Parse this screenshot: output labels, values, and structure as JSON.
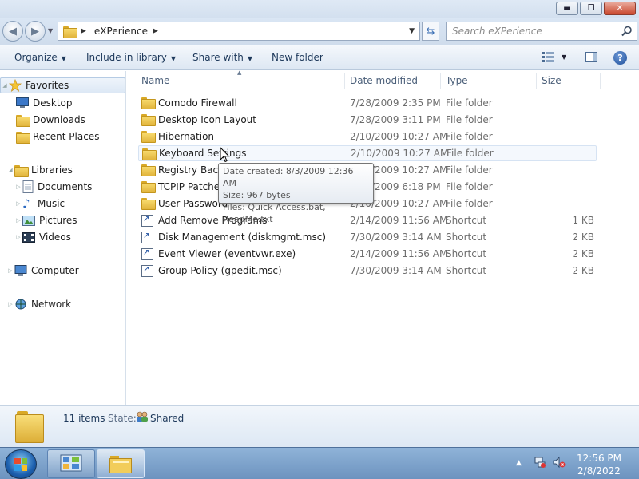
{
  "window": {
    "buttons": {
      "minimize": "▬",
      "maximize": "❐",
      "close": "✕"
    }
  },
  "address": {
    "path_segment": "eXPerience",
    "search_placeholder": "Search eXPerience"
  },
  "toolbar": {
    "organize": "Organize",
    "include_in_library": "Include in library",
    "share_with": "Share with",
    "new_folder": "New folder",
    "help": "?"
  },
  "nav": {
    "favorites": "Favorites",
    "desktop": "Desktop",
    "downloads": "Downloads",
    "recent_places": "Recent Places",
    "libraries": "Libraries",
    "documents": "Documents",
    "music": "Music",
    "pictures": "Pictures",
    "videos": "Videos",
    "computer": "Computer",
    "network": "Network"
  },
  "columns": {
    "name": "Name",
    "date": "Date modified",
    "type": "Type",
    "size": "Size"
  },
  "files": [
    {
      "name": "Comodo Firewall",
      "date": "7/28/2009 2:35 PM",
      "type": "File folder",
      "size": "",
      "icon": "folder-icon"
    },
    {
      "name": "Desktop Icon Layout",
      "date": "7/28/2009 3:11 PM",
      "type": "File folder",
      "size": "",
      "icon": "folder-icon"
    },
    {
      "name": "Hibernation",
      "date": "2/10/2009 10:27 AM",
      "type": "File folder",
      "size": "",
      "icon": "folder-icon"
    },
    {
      "name": "Keyboard Settings",
      "date": "2/10/2009 10:27 AM",
      "type": "File folder",
      "size": "",
      "icon": "folder-icon"
    },
    {
      "name": "Registry Backup",
      "date": "2/10/2009 10:27 AM",
      "type": "File folder",
      "size": "",
      "icon": "folder-icon"
    },
    {
      "name": "TCPIP Patcher",
      "date": "2/10/2009 6:18 PM",
      "type": "File folder",
      "size": "",
      "icon": "folder-icon"
    },
    {
      "name": "User Password",
      "date": "2/10/2009 10:27 AM",
      "type": "File folder",
      "size": "",
      "icon": "folder-icon"
    },
    {
      "name": "Add Remove Programs",
      "date": "2/14/2009 11:56 AM",
      "type": "Shortcut",
      "size": "1 KB",
      "icon": "shortcut-icon"
    },
    {
      "name": "Disk Management (diskmgmt.msc)",
      "date": "7/30/2009 3:14 AM",
      "type": "Shortcut",
      "size": "2 KB",
      "icon": "shortcut-icon"
    },
    {
      "name": "Event Viewer (eventvwr.exe)",
      "date": "2/14/2009 11:56 AM",
      "type": "Shortcut",
      "size": "2 KB",
      "icon": "shortcut-icon"
    },
    {
      "name": "Group Policy (gpedit.msc)",
      "date": "7/30/2009 3:14 AM",
      "type": "Shortcut",
      "size": "2 KB",
      "icon": "shortcut-icon"
    }
  ],
  "tooltip": {
    "line1": "Date created: 8/3/2009 12:36 AM",
    "line2": "Size: 967 bytes",
    "line3": "Files: Quick Access.bat, ReadMe.txt"
  },
  "details": {
    "count": "11 items",
    "state_label": "State:",
    "state_value": "Shared"
  },
  "taskbar": {
    "time": "12:56 PM",
    "date": "2/8/2022"
  },
  "colors": {
    "accent": "#1e395b",
    "folder": "#e1b43c",
    "taskbar": "#7ca1cb"
  }
}
